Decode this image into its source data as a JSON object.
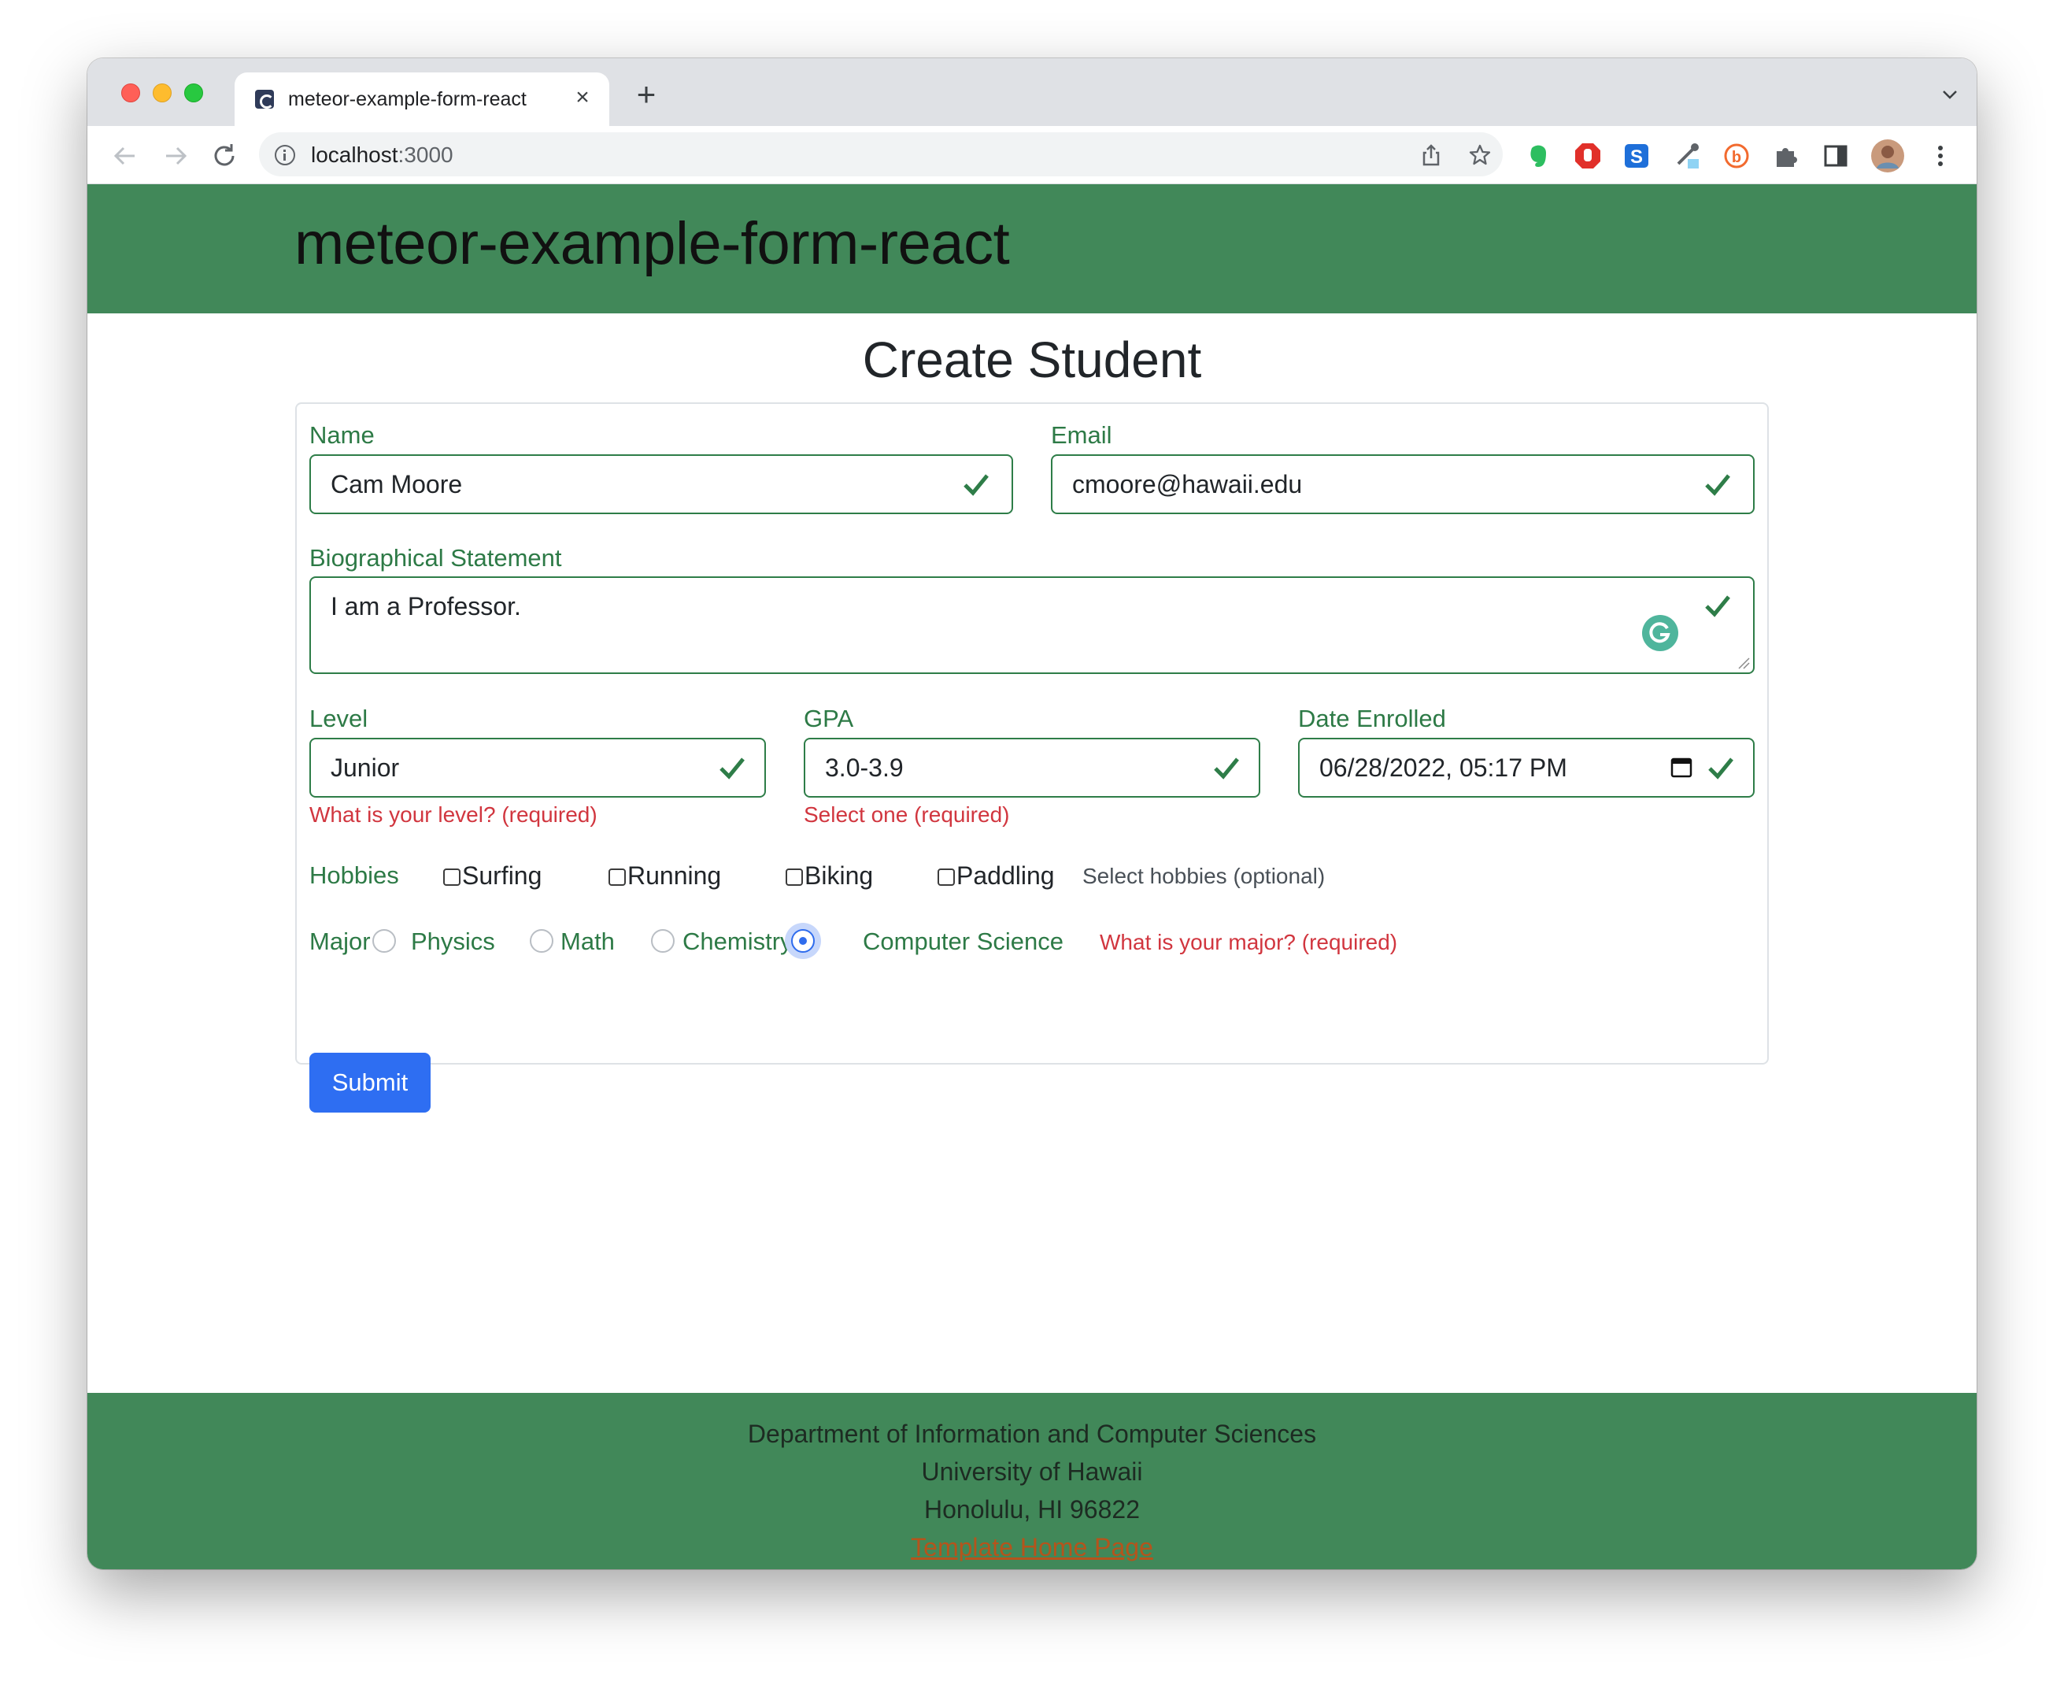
{
  "browser": {
    "tab_title": "meteor-example-form-react",
    "url_host": "localhost",
    "url_port": ":3000"
  },
  "app": {
    "title": "meteor-example-form-react"
  },
  "page": {
    "heading": "Create Student"
  },
  "form": {
    "name": {
      "label": "Name",
      "value": "Cam Moore"
    },
    "email": {
      "label": "Email",
      "value": "cmoore@hawaii.edu"
    },
    "bio": {
      "label": "Biographical Statement",
      "value": "I am a Professor."
    },
    "level": {
      "label": "Level",
      "value": "Junior",
      "error": "What is your level? (required)"
    },
    "gpa": {
      "label": "GPA",
      "value": "3.0-3.9",
      "error": "Select one (required)"
    },
    "date": {
      "label": "Date Enrolled",
      "value": "06/28/2022, 05:17 PM"
    },
    "hobbies": {
      "label": "Hobbies",
      "options": [
        "Surfing",
        "Running",
        "Biking",
        "Paddling"
      ],
      "help": "Select hobbies (optional)"
    },
    "major": {
      "label": "Major",
      "options": [
        "Physics",
        "Math",
        "Chemistry",
        "Computer Science"
      ],
      "selected": "Computer Science",
      "error": "What is your major? (required)"
    },
    "submit_label": "Submit"
  },
  "footer": {
    "line1": "Department of Information and Computer Sciences",
    "line2": "University of Hawaii",
    "line3": "Honolulu, HI 96822",
    "link": "Template Home Page"
  },
  "colors": {
    "header_green": "#418859",
    "valid_green": "#2e7d48",
    "error_red": "#d1363f",
    "primary_blue": "#2e6ef2"
  }
}
